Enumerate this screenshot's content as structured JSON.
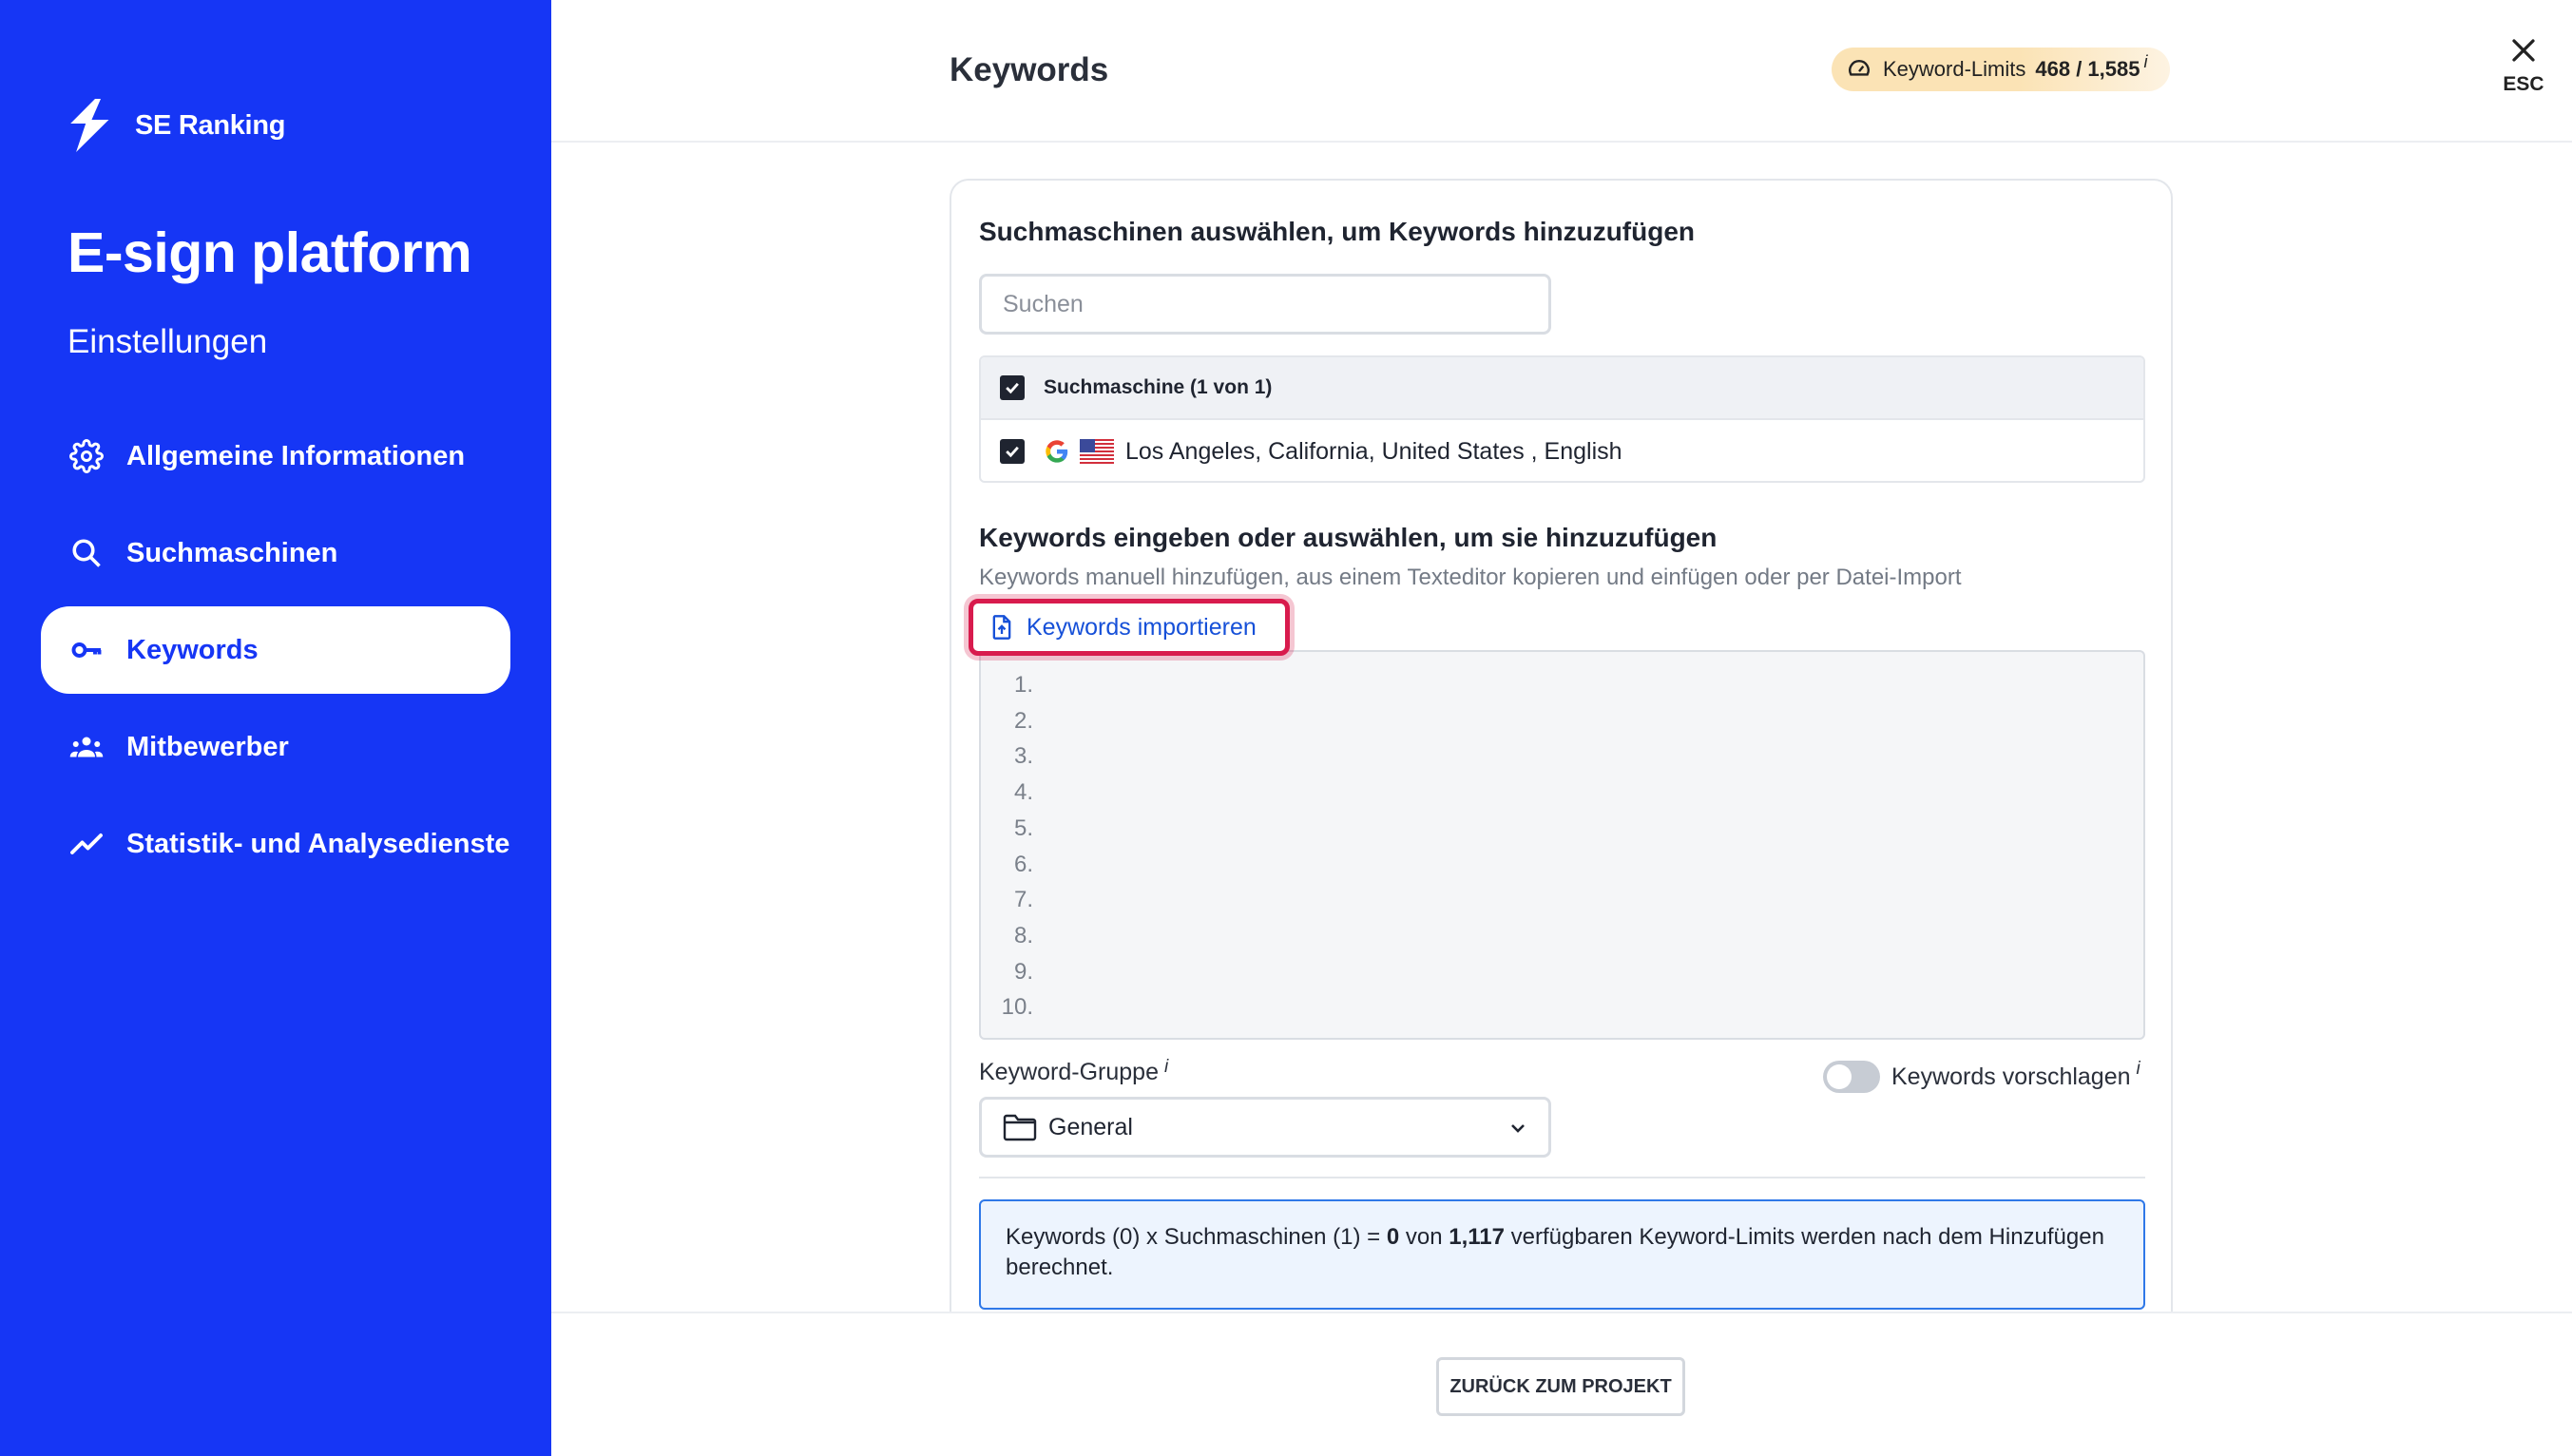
{
  "app": {
    "brand": "SE Ranking",
    "project_title": "E-sign platform",
    "project_subtitle": "Einstellungen"
  },
  "sidebar": {
    "items": [
      {
        "label": "Allgemeine Informationen",
        "icon": "gear-icon",
        "active": false
      },
      {
        "label": "Suchmaschinen",
        "icon": "search-icon",
        "active": false
      },
      {
        "label": "Keywords",
        "icon": "key-icon",
        "active": true
      },
      {
        "label": "Mitbewerber",
        "icon": "users-icon",
        "active": false
      },
      {
        "label": "Statistik- und Analysedienste",
        "icon": "trend-line-icon",
        "active": false
      }
    ]
  },
  "header": {
    "title": "Keywords",
    "limits_label": "Keyword-Limits",
    "limits_value": "468 / 1,585",
    "limits_info": "i",
    "esc_label": "ESC"
  },
  "engines": {
    "section_title": "Suchmaschinen auswählen, um Keywords hinzuzufügen",
    "search_placeholder": "Suchen",
    "header_label": "Suchmaschine (1 von 1)",
    "rows": [
      {
        "label": "Los Angeles, California, United States , English",
        "checked": true
      }
    ]
  },
  "keywords": {
    "section_title": "Keywords eingeben oder auswählen, um sie hinzuzufügen",
    "subtext": "Keywords manuell hinzufügen, aus einem Texteditor kopieren und einfügen oder per Datei-Import",
    "import_label": "Keywords importieren",
    "line_numbers": [
      "1.",
      "2.",
      "3.",
      "4.",
      "5.",
      "6.",
      "7.",
      "8.",
      "9.",
      "10."
    ]
  },
  "group": {
    "label": "Keyword-Gruppe",
    "info": "i",
    "selected": "General"
  },
  "suggest": {
    "label": "Keywords vorschlagen",
    "info": "i",
    "enabled": false
  },
  "notice": {
    "part1": "Keywords (0) x Suchmaschinen (1) = ",
    "count": "0",
    "part2": " von ",
    "available": "1,117",
    "part3": " verfügbaren Keyword-Limits werden nach dem Hinzufügen berechnet."
  },
  "footer": {
    "back_label": "ZURÜCK ZUM PROJEKT"
  },
  "colors": {
    "brand_blue": "#1636f5",
    "highlight_red": "#d81b4d",
    "link_blue": "#1650d8",
    "notice_border": "#2f78e8"
  }
}
